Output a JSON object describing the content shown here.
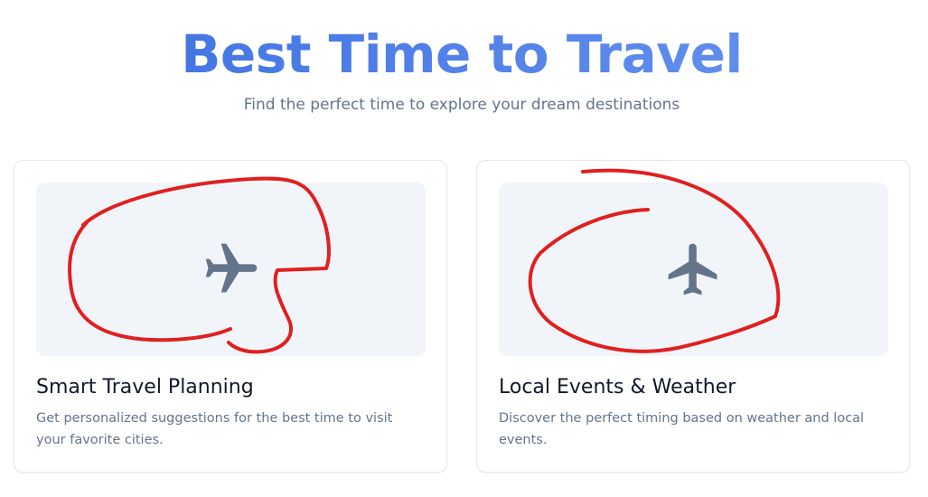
{
  "colors": {
    "title_gradient_start": "#3b6fe0",
    "title_gradient_end": "#6a95f0",
    "icon": "#64748b",
    "annotation": "#e02020"
  },
  "hero": {
    "title": "Best Time to Travel",
    "subtitle": "Find the perfect time to explore your dream destinations"
  },
  "features": [
    {
      "icon": "airplane-icon",
      "title": "Smart Travel Planning",
      "description": "Get personalized suggestions for the best time to visit your favorite cities."
    },
    {
      "icon": "airplane-icon",
      "title": "Local Events & Weather",
      "description": "Discover the perfect timing based on weather and local events."
    }
  ]
}
